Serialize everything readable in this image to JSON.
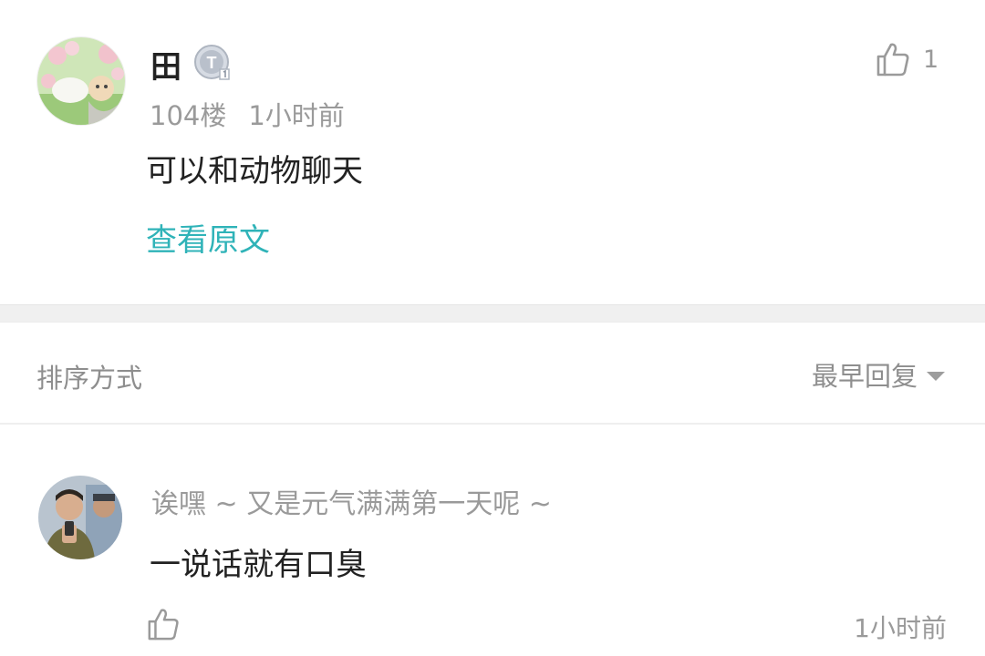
{
  "post": {
    "username": "田",
    "level_badge": "T",
    "floor": "104楼",
    "time": "1小时前",
    "content": "可以和动物聊天",
    "view_original": "查看原文",
    "like_count": "1",
    "avatar_icon": "anime-avatar-icon",
    "like_icon": "thumbs-up-icon"
  },
  "sort": {
    "label": "排序方式",
    "value": "最早回复",
    "caret_icon": "caret-down-icon"
  },
  "reply": {
    "username": "诶嘿 ~ 又是元气满满第一天呢 ~",
    "content": "一说话就有口臭",
    "time": "1小时前",
    "avatar_icon": "photo-avatar-icon",
    "like_icon": "thumbs-up-icon"
  },
  "colors": {
    "accent": "#2fb3b8",
    "muted_text": "#9a9a9a",
    "divider": "#f0f0f0"
  }
}
